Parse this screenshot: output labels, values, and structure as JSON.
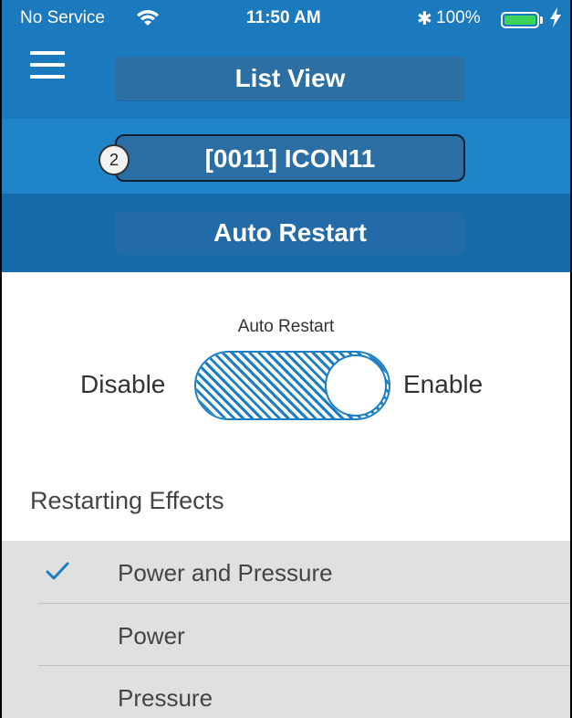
{
  "status_bar": {
    "carrier": "No Service",
    "time": "11:50 AM",
    "bluetooth": "✱",
    "battery_percent": "100%",
    "battery_level": 1.0,
    "battery_color": "#3cd45a"
  },
  "header": {
    "menu_icon": "hamburger-menu-icon",
    "list_view_label": "List View",
    "device_badge": "2",
    "device_label": "[0011] ICON11",
    "page_label": "Auto Restart",
    "accent_color": "#1b79bd"
  },
  "toggle": {
    "caption": "Auto Restart",
    "off_label": "Disable",
    "on_label": "Enable",
    "state": "enabled"
  },
  "restarting_effects": {
    "title": "Restarting Effects",
    "items": [
      {
        "label": "Power and Pressure",
        "checked": true
      },
      {
        "label": "Power",
        "checked": false
      },
      {
        "label": "Pressure",
        "checked": false
      }
    ]
  }
}
